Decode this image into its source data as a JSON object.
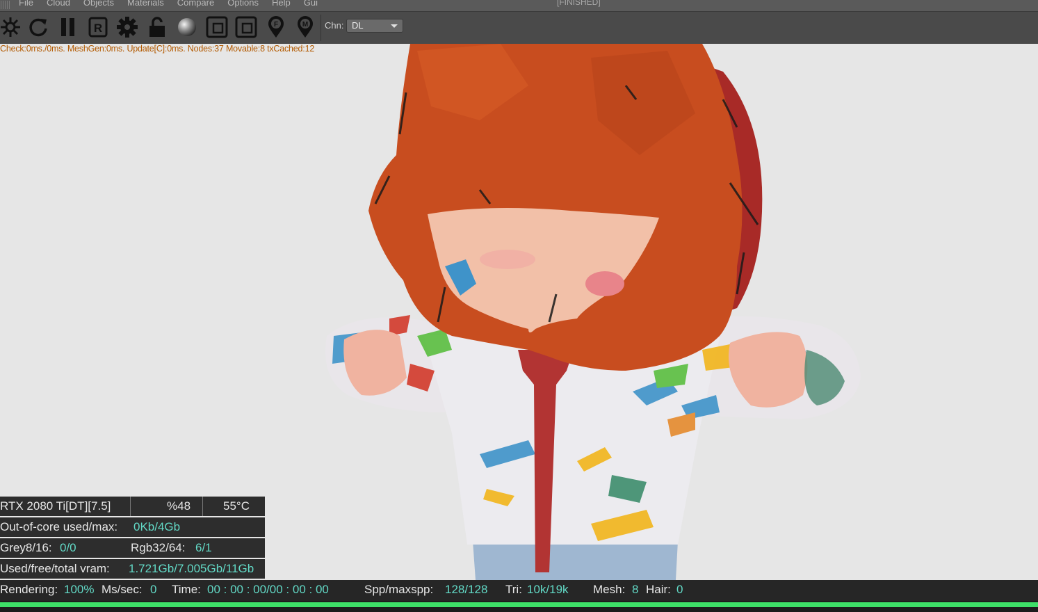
{
  "menu": {
    "items": [
      "File",
      "Cloud",
      "Objects",
      "Materials",
      "Compare",
      "Options",
      "Help",
      "Gui"
    ],
    "status": "[FINISHED]"
  },
  "toolbar": {
    "icons": [
      "render-settings-icon",
      "restart-icon",
      "pause-icon",
      "r-icon",
      "gear-icon",
      "lock-icon",
      "material-ball-icon",
      "region-icon",
      "film-region-icon",
      "f-pin-icon",
      "m-pin-icon"
    ],
    "channel_label": "Chn:",
    "channel_value": "DL"
  },
  "info_line": "Check:0ms./0ms. MeshGen:0ms. Update[C]:0ms. Nodes:37 Movable:8 txCached:12",
  "stats": {
    "gpu": "RTX 2080 Ti[DT][7.5]",
    "usage": "%48",
    "temp": "55°C",
    "ooc_label": "Out-of-core used/max:",
    "ooc_value": "0Kb/4Gb",
    "grey_label": "Grey8/16:",
    "grey_value": "0/0",
    "rgb_label": "Rgb32/64:",
    "rgb_value": "6/1",
    "vram_label": "Used/free/total vram:",
    "vram_value": "1.721Gb/7.005Gb/11Gb"
  },
  "statusbar": {
    "rendering_label": "Rendering:",
    "rendering_value": "100%",
    "ms_label": "Ms/sec:",
    "ms_value": "0",
    "time_label": "Time:",
    "time_value": "00 : 00 : 00/00 : 00 : 00",
    "spp_label": "Spp/maxspp:",
    "spp_value": "128/128",
    "tri_label": "Tri:",
    "tri_value": "10k/19k",
    "mesh_label": "Mesh:",
    "mesh_value": "8",
    "hair_label": "Hair:",
    "hair_value": "0"
  },
  "progress": 1.0,
  "colors": {
    "accent_value": "#62d9c6",
    "progress": "#3ee068",
    "info_text": "#b35a00"
  }
}
